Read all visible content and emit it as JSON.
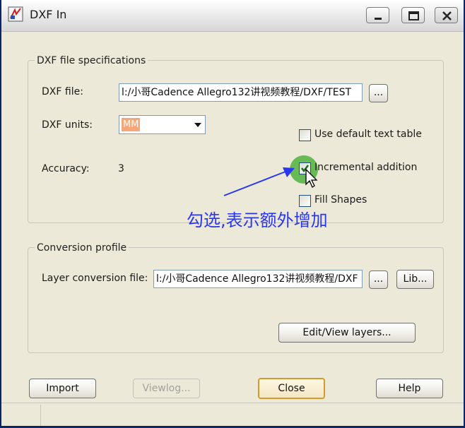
{
  "window": {
    "title": "DXF In",
    "buttons": [
      "minimize-icon",
      "maximize-icon",
      "close-icon"
    ]
  },
  "spec_group": {
    "label": "DXF file specifications",
    "file_label": "DXF file:",
    "file_value": "l:/小哥Cadence Allegro132讲视频教程/DXF/TEST",
    "browse_label": "...",
    "units_label": "DXF units:",
    "units_value": "MM",
    "accuracy_label": "Accuracy:",
    "accuracy_value": "3",
    "use_default_text_table_label": "Use default text table",
    "use_default_text_table_checked": false,
    "incremental_addition_label": "Incremental addition",
    "incremental_addition_checked": true,
    "fill_shapes_label": "Fill Shapes",
    "fill_shapes_checked": false
  },
  "conversion_group": {
    "label": "Conversion profile",
    "layer_file_label": "Layer conversion file:",
    "layer_file_value": "l:/小哥Cadence Allegro132讲视频教程/DXF",
    "browse_label": "...",
    "lib_label": "Lib...",
    "edit_view_label": "Edit/View layers..."
  },
  "footer": {
    "import_label": "Import",
    "viewlog_label": "Viewlog...",
    "close_label": "Close",
    "help_label": "Help"
  },
  "annotation": {
    "text": "勾选,表示额外增加",
    "color": "#2a37f0"
  },
  "colors": {
    "window_bg": "#ece9d8",
    "highlight": "#3caa28",
    "default_button_border": "#d49b2c"
  }
}
